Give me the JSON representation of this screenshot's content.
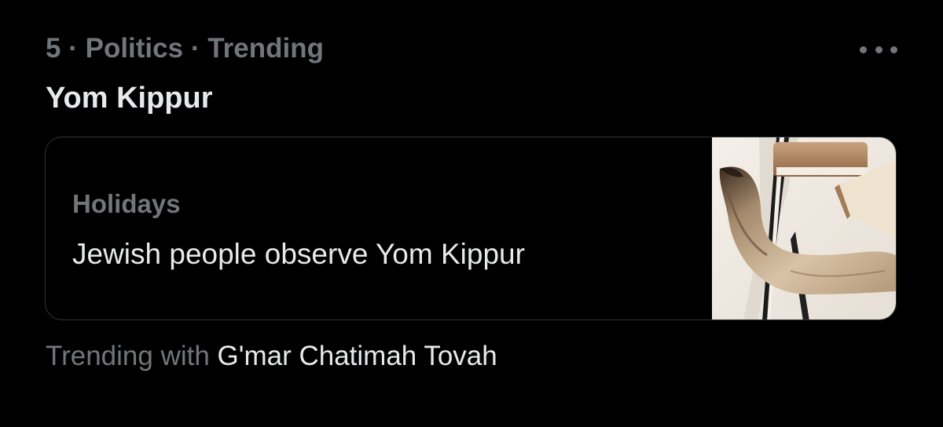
{
  "trend": {
    "rank": "5",
    "separator": "·",
    "category": "Politics",
    "status": "Trending",
    "title": "Yom Kippur",
    "more_icon": "ellipsis-icon"
  },
  "card": {
    "category": "Holidays",
    "headline": "Jewish people observe Yom Kippur",
    "thumbnail_icon": "shofar-image"
  },
  "footer": {
    "lead": "Trending with",
    "tag": "G'mar Chatimah Tovah"
  },
  "colors": {
    "background": "#000000",
    "primary_text": "#e7e9ea",
    "secondary_text": "#71767b",
    "border": "#2f3336"
  }
}
